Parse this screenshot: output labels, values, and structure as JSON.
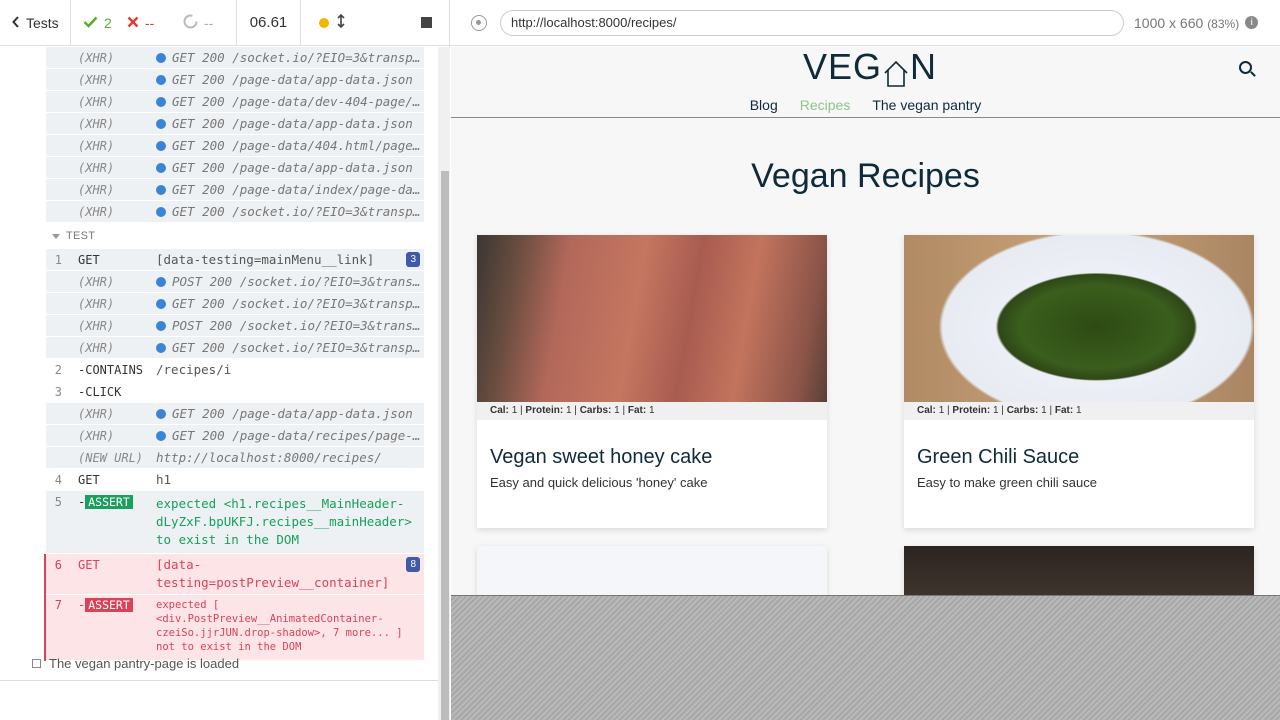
{
  "runner": {
    "tests_label": "Tests",
    "passed": "2",
    "failed": "--",
    "pending": "--",
    "duration": "06.61",
    "colors": {
      "pass": "#5eac2f",
      "fail": "#e53935",
      "pending": "#aaaaaa",
      "running": "#f5b400"
    }
  },
  "commands_before": [
    {
      "name": "(XHR)",
      "msg": "GET 200 /socket.io/?EIO=3&transpo…"
    },
    {
      "name": "(XHR)",
      "msg": "GET 200 /page-data/app-data.json"
    },
    {
      "name": "(XHR)",
      "msg": "GET 200 /page-data/dev-404-page/p…"
    },
    {
      "name": "(XHR)",
      "msg": "GET 200 /page-data/app-data.json"
    },
    {
      "name": "(XHR)",
      "msg": "GET 200 /page-data/404.html/page-…"
    },
    {
      "name": "(XHR)",
      "msg": "GET 200 /page-data/app-data.json"
    },
    {
      "name": "(XHR)",
      "msg": "GET 200 /page-data/index/page-dat…"
    },
    {
      "name": "(XHR)",
      "msg": "GET 200 /socket.io/?EIO=3&transpo…"
    }
  ],
  "test_section_label": "TEST",
  "cmd1": {
    "num": "1",
    "name": "GET",
    "msg": "[data-testing=mainMenu__link]",
    "count": "3"
  },
  "xhr_after_get": [
    {
      "name": "(XHR)",
      "msg": "POST 200 /socket.io/?EIO=3&transp…"
    },
    {
      "name": "(XHR)",
      "msg": "GET 200 /socket.io/?EIO=3&transpo…"
    },
    {
      "name": "(XHR)",
      "msg": "POST 200 /socket.io/?EIO=3&transp…"
    },
    {
      "name": "(XHR)",
      "msg": "GET 200 /socket.io/?EIO=3&transpo…"
    }
  ],
  "cmd2": {
    "num": "2",
    "name": "-CONTAINS",
    "msg": "/recipes/i"
  },
  "cmd3": {
    "num": "3",
    "name": "-CLICK",
    "msg": ""
  },
  "xhr_after_click": [
    {
      "name": "(XHR)",
      "msg": "GET 200 /page-data/app-data.json"
    },
    {
      "name": "(XHR)",
      "msg": "GET 200 /page-data/recipes/page-d…"
    }
  ],
  "new_url": {
    "name": "(NEW URL)",
    "msg": "http://localhost:8000/recipes/"
  },
  "cmd4": {
    "num": "4",
    "name": "GET",
    "msg": "h1"
  },
  "cmd5": {
    "num": "5",
    "name": "-",
    "badge": "ASSERT",
    "msg_prefix": "expected",
    "msg": "<h1.recipes__MainHeader-dLyZxF.bpUKFJ.recipes__mainHeader>",
    "msg_suffix": "to exist in the DOM"
  },
  "cmd6": {
    "num": "6",
    "name": "GET",
    "msg": "[data-testing=postPreview__container]",
    "count": "8"
  },
  "cmd7": {
    "num": "7",
    "name": "-",
    "badge": "ASSERT",
    "msg": "expected [ <div.PostPreview__AnimatedContainer-czeiSo.jjrJUN.drop-shadow>, 7 more... ] not to exist in the DOM"
  },
  "pending_test": "The vegan pantry-page is loaded",
  "browser": {
    "url": "http://localhost:8000/recipes/",
    "viewport": "1000 x 660",
    "scale": "(83%)",
    "info": "i"
  },
  "app": {
    "logo_left": "VEG",
    "logo_right": "N",
    "nav": [
      {
        "label": "Blog",
        "active": false
      },
      {
        "label": "Recipes",
        "active": true
      },
      {
        "label": "The vegan pantry",
        "active": false
      }
    ],
    "nav_active_color": "#8fc48b",
    "title": "Vegan Recipes",
    "cards": [
      {
        "macros": {
          "cal": "1",
          "protein": "1",
          "carbs": "1",
          "fat": "1"
        },
        "title": "Vegan sweet honey cake",
        "desc": "Easy and quick delicious 'honey' cake"
      },
      {
        "macros": {
          "cal": "1",
          "protein": "1",
          "carbs": "1",
          "fat": "1"
        },
        "title": "Green Chili Sauce",
        "desc": "Easy to make green chili sauce"
      }
    ],
    "macro_labels": {
      "cal": "Cal:",
      "protein": "Protein:",
      "carbs": "Carbs:",
      "fat": "Fat:"
    }
  }
}
